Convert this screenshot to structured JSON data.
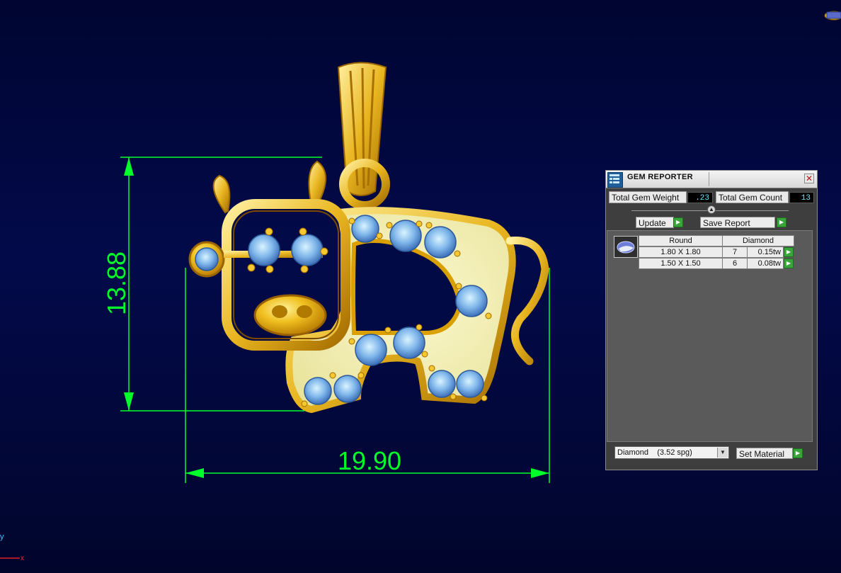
{
  "viewport": {
    "background_color": "#01073a",
    "dimension_color": "#00ff2a",
    "dimensions": {
      "height": "13.88",
      "width": "19.90"
    },
    "axis_labels": {
      "y": "y",
      "x": "x"
    }
  },
  "gem_reporter": {
    "title": "GEM REPORTER",
    "total_weight_label": "Total Gem Weight",
    "total_weight_value": ".23",
    "total_count_label": "Total Gem Count",
    "total_count_value": "13",
    "update_label": "Update",
    "save_report_label": "Save Report",
    "table": {
      "headers": [
        "Round",
        "Diamond"
      ],
      "rows": [
        {
          "size": "1.80 X 1.80",
          "count": "7",
          "weight": "0.15tw"
        },
        {
          "size": "1.50 X 1.50",
          "count": "6",
          "weight": "0.08tw"
        }
      ]
    },
    "material_selected": "Diamond    (3.52 spg)",
    "set_material_label": "Set Material",
    "icons": [
      "gem-reporter-icon",
      "close-icon",
      "slider-handle-icon",
      "play-icon",
      "gem-thumbnail-icon",
      "dropdown-arrow-icon"
    ]
  }
}
